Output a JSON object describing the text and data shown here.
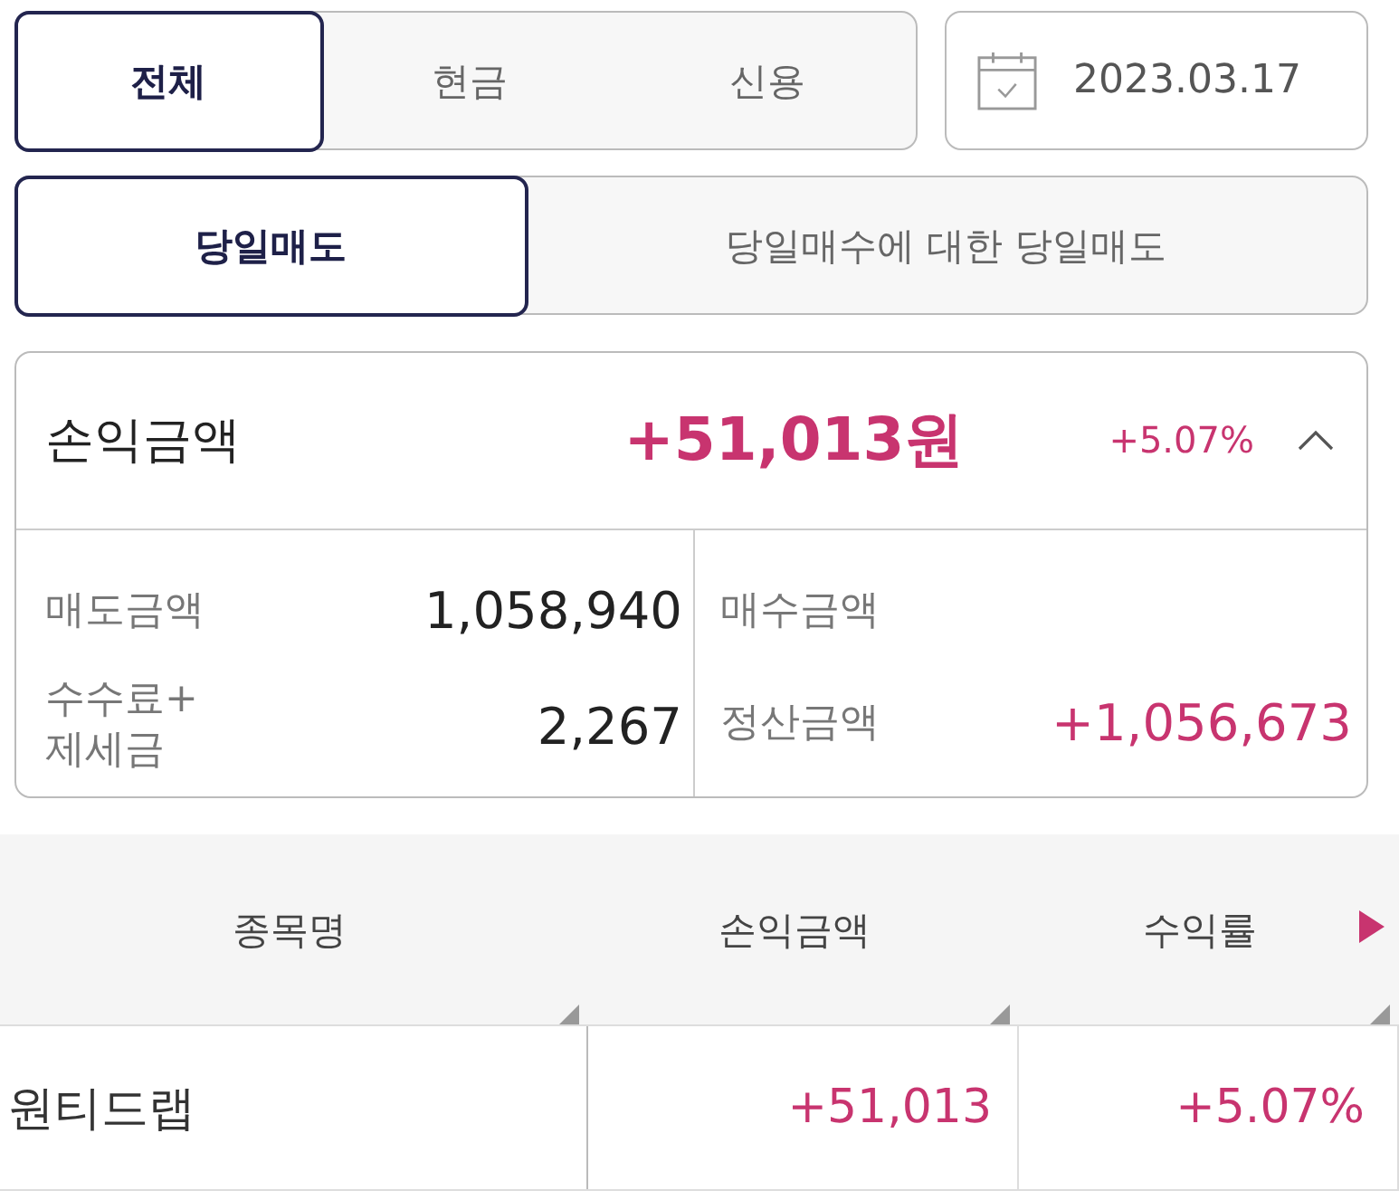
{
  "account_tabs": [
    {
      "label": "전체",
      "selected": true
    },
    {
      "label": "현금",
      "selected": false
    },
    {
      "label": "신용",
      "selected": false
    }
  ],
  "date": {
    "value": "2023.03.17"
  },
  "mode_tabs": [
    {
      "label": "당일매도",
      "selected": true
    },
    {
      "label": "당일매수에 대한 당일매도",
      "selected": false
    }
  ],
  "summary": {
    "title": "손익금액",
    "amount": "+51,013원",
    "rate": "+5.07%",
    "expanded": true,
    "left": [
      {
        "label": "매도금액",
        "value": "1,058,940"
      },
      {
        "label": "수수료+\n제세금",
        "value": "2,267"
      }
    ],
    "right": [
      {
        "label": "매수금액"
      },
      {
        "label": "정산금액",
        "value": "+1,056,673"
      }
    ]
  },
  "table": {
    "columns": [
      "종목명",
      "손익금액",
      "수익률"
    ],
    "rows": [
      [
        "원티드랩",
        "+51,013",
        "+5.07%"
      ]
    ]
  }
}
